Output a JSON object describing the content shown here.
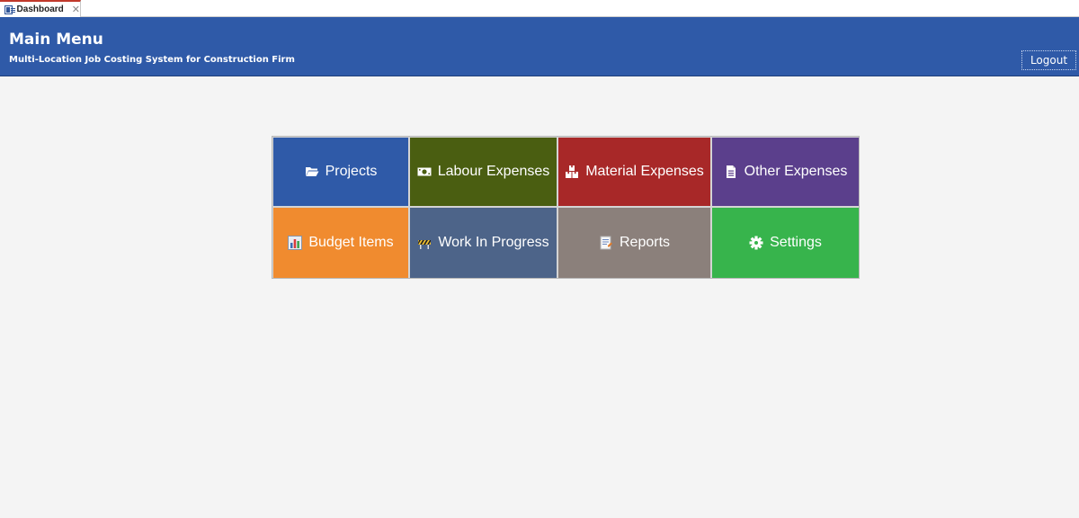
{
  "tab": {
    "label": "Dashboard",
    "close": "✕"
  },
  "header": {
    "title": "Main Menu",
    "subtitle": "Multi-Location Job Costing System for Construction Firm",
    "logout_label": "Logout",
    "bg_color": "#2f5aa8"
  },
  "tiles": [
    {
      "label": "Projects",
      "icon": "folder-open-icon",
      "color": "#2f5aa8"
    },
    {
      "label": "Labour Expenses",
      "icon": "money-icon",
      "color": "#4a5e11"
    },
    {
      "label": "Material Expenses",
      "icon": "boxes-icon",
      "color": "#a82828"
    },
    {
      "label": "Other Expenses",
      "icon": "document-icon",
      "color": "#5b3f8c"
    },
    {
      "label": "Budget Items",
      "icon": "bar-chart-icon",
      "color": "#f08b2f"
    },
    {
      "label": "Work In Progress",
      "icon": "construction-barrier-icon",
      "color": "#4d6489"
    },
    {
      "label": "Reports",
      "icon": "report-icon",
      "color": "#8b807b"
    },
    {
      "label": "Settings",
      "icon": "gear-icon",
      "color": "#37b44c"
    }
  ]
}
